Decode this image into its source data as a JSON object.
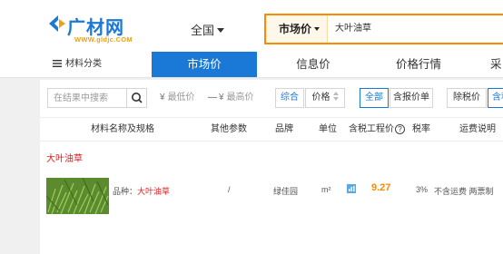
{
  "logo": {
    "text": "广材网",
    "url_text": "WWW.gldjc.COM",
    "brand_color": "#1a78d6",
    "accent_color": "#e9a21a"
  },
  "header": {
    "region": "全国",
    "search": {
      "type": "市场价",
      "value": "大叶油草"
    }
  },
  "nav": {
    "category_label": "材料分类",
    "items": [
      {
        "label": "市场价",
        "active": true
      },
      {
        "label": "信息价",
        "active": false
      },
      {
        "label": "价格行情",
        "active": false
      },
      {
        "label": "采",
        "active": false
      }
    ]
  },
  "filter": {
    "search_placeholder": "在结果中搜索",
    "min_price_placeholder": "最低价",
    "max_price_placeholder": "最高价",
    "dash": "—",
    "yen": "¥",
    "sort_composite": "综合",
    "sort_price": "价格",
    "tabs": [
      "全部",
      "含报价单"
    ],
    "tax_options": [
      "除税价",
      "含税"
    ]
  },
  "table": {
    "headers": {
      "name": "材料名称及规格",
      "other": "其他参数",
      "brand": "品牌",
      "unit": "单位",
      "tax_price": "含税工程价",
      "tax_rate": "税率",
      "shipping": "运费说明"
    },
    "group_title": "大叶油草",
    "rows": [
      {
        "brand_label": "品种：",
        "brand_value": "大叶油草",
        "other": "/",
        "brand": "绿佳园",
        "unit": "m²",
        "price": "9.27",
        "tax_rate": "3%",
        "shipping": "不含运费 两票制"
      }
    ]
  },
  "colors": {
    "accent": "#ff8a00",
    "primary": "#1a78d6",
    "highlight": "#e02020"
  }
}
